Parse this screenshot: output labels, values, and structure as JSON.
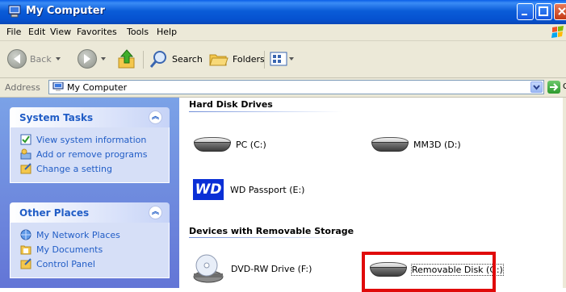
{
  "window": {
    "title": "My Computer"
  },
  "menu": [
    "File",
    "Edit",
    "View",
    "Favorites",
    "Tools",
    "Help"
  ],
  "toolbar": {
    "back_label": "Back",
    "search_label": "Search",
    "folders_label": "Folders"
  },
  "address": {
    "label": "Address",
    "value": "My Computer",
    "go_label": "Go"
  },
  "left_pane": {
    "system_tasks": {
      "title": "System Tasks",
      "items": [
        "View system information",
        "Add or remove programs",
        "Change a setting"
      ]
    },
    "other_places": {
      "title": "Other Places",
      "items": [
        "My Network Places",
        "My Documents",
        "Control Panel"
      ]
    }
  },
  "content": {
    "hard_disk_header": "Hard Disk Drives",
    "drives": [
      "PC (C:)",
      "MM3D (D:)",
      "WD Passport (E:)"
    ],
    "wd_logo_text": "WD",
    "removable_header": "Devices with Removable Storage",
    "removable": [
      "DVD-RW Drive (F:)",
      "Removable Disk (G:)"
    ]
  },
  "colors": {
    "highlight_border": "#e00a0a",
    "task_link": "#215dc6",
    "titlebar": "#0a5cd8"
  }
}
